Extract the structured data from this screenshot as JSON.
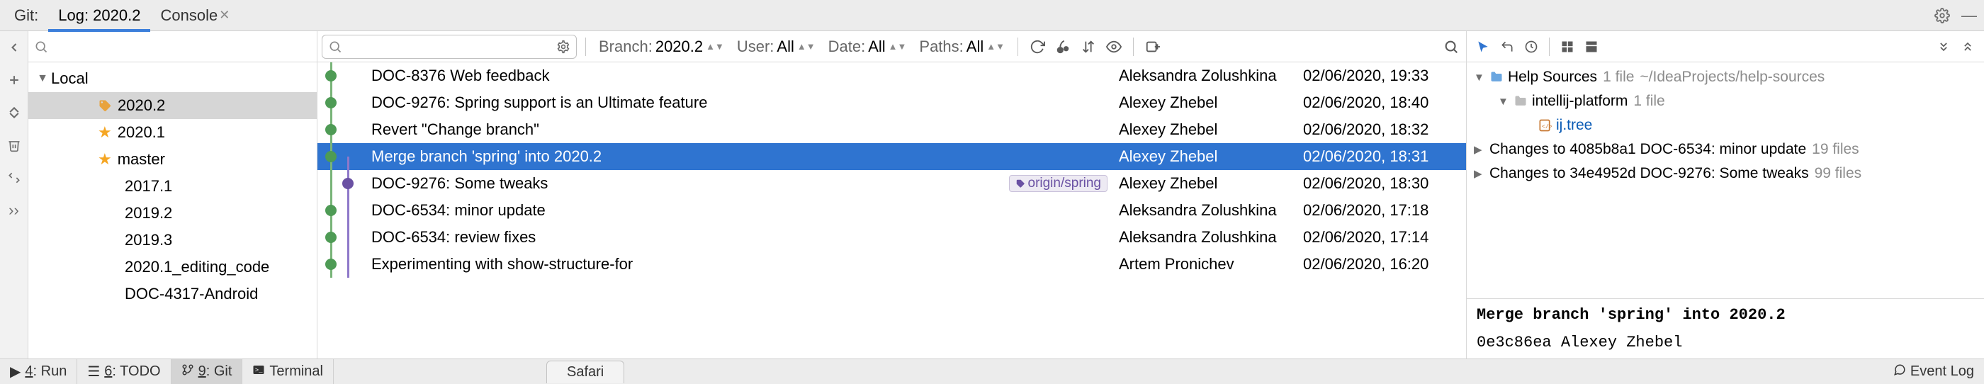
{
  "tabs": {
    "git": "Git:",
    "log": "Log: 2020.2",
    "console": "Console"
  },
  "branches": {
    "local_label": "Local",
    "items": [
      {
        "name": "2020.2",
        "flag": "tag",
        "selected": true
      },
      {
        "name": "2020.1",
        "flag": "star"
      },
      {
        "name": "master",
        "flag": "star"
      },
      {
        "name": "2017.1"
      },
      {
        "name": "2019.2"
      },
      {
        "name": "2019.3"
      },
      {
        "name": "2020.1_editing_code"
      },
      {
        "name": "DOC-4317-Android"
      }
    ]
  },
  "logFilters": {
    "branch_label": "Branch:",
    "branch_val": "2020.2",
    "user_label": "User:",
    "user_val": "All",
    "date_label": "Date:",
    "date_val": "All",
    "paths_label": "Paths:",
    "paths_val": "All"
  },
  "commits": [
    {
      "msg": "DOC-8376 Web feedback",
      "author": "Aleksandra Zolushkina",
      "date": "02/06/2020, 19:33"
    },
    {
      "msg": "DOC-9276: Spring support is an Ultimate feature",
      "author": "Alexey Zhebel",
      "date": "02/06/2020, 18:40"
    },
    {
      "msg": "Revert \"Change branch\"",
      "author": "Alexey Zhebel",
      "date": "02/06/2020, 18:32"
    },
    {
      "msg": "Merge branch 'spring' into 2020.2",
      "author": "Alexey Zhebel",
      "date": "02/06/2020, 18:31",
      "selected": true
    },
    {
      "msg": "DOC-9276: Some tweaks",
      "ref": "origin/spring",
      "author": "Alexey Zhebel",
      "date": "02/06/2020, 18:30",
      "branch2": true
    },
    {
      "msg": "DOC-6534: minor update",
      "author": "Aleksandra Zolushkina",
      "date": "02/06/2020, 17:18"
    },
    {
      "msg": "DOC-6534: review fixes",
      "author": "Aleksandra Zolushkina",
      "date": "02/06/2020, 17:14"
    },
    {
      "msg": "Experimenting with show-structure-for",
      "author": "Artem Pronichev",
      "date": "02/06/2020, 16:20"
    }
  ],
  "details": {
    "root_label": "Help Sources",
    "root_count": "1 file",
    "root_path": "~/IdeaProjects/help-sources",
    "folder_label": "intellij-platform",
    "folder_count": "1 file",
    "file_label": "ij.tree",
    "change1_a": "Changes to 4085b8a1 DOC-6534: minor update",
    "change1_b": "19 files",
    "change2_a": "Changes to 34e4952d DOC-9276: Some tweaks",
    "change2_b": "99 files",
    "commit_msg": "Merge branch 'spring' into 2020.2",
    "commit_meta": "0e3c86ea Alexey Zhebel"
  },
  "bottom": {
    "run": "Run",
    "run_key": "4",
    "todo": "TODO",
    "todo_key": "6",
    "git": "Git",
    "git_key": "9",
    "terminal": "Terminal",
    "safari": "Safari",
    "event_log": "Event Log"
  }
}
